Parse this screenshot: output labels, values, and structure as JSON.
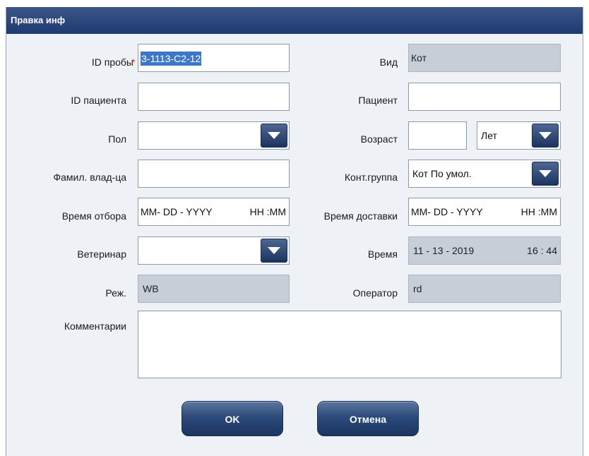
{
  "window": {
    "title": "Правка инф"
  },
  "sample_id": {
    "label": "ID пробы",
    "required_mark": "*",
    "value": "3-1113-C2-12"
  },
  "species": {
    "label": "Вид",
    "value": "Кот"
  },
  "patient_id": {
    "label": "ID пациента",
    "value": ""
  },
  "patient": {
    "label": "Пациент",
    "value": ""
  },
  "sex": {
    "label": "Пол",
    "value": ""
  },
  "age": {
    "label": "Возраст",
    "value": "",
    "unit": "Лет"
  },
  "owner": {
    "label": "Фамил. влад-ца",
    "value": ""
  },
  "ref_group": {
    "label": "Конт.группа",
    "value": "Кот По умол."
  },
  "draw_time": {
    "label": "Время отбора",
    "date": "MM- DD -  YYYY",
    "time": "HH :MM"
  },
  "delivery_time": {
    "label": "Время доставки",
    "date": "MM- DD -  YYYY",
    "time": "HH :MM"
  },
  "vet": {
    "label": "Ветеринар",
    "value": ""
  },
  "time": {
    "label": "Время",
    "date": "11 - 13 -  2019",
    "time": "16 : 44"
  },
  "mode": {
    "label": "Реж.",
    "value": "WB"
  },
  "operator": {
    "label": "Оператор",
    "value": "rd"
  },
  "comments": {
    "label": "Комментарии",
    "value": ""
  },
  "buttons": {
    "ok": "OK",
    "cancel": "Отмена"
  },
  "icons": {
    "dropdown": "chevron-down-icon"
  },
  "colors": {
    "titlebar": "#1e3a70",
    "button": "#2c4a7a",
    "readonly_field": "#c7ced8",
    "required": "#d42a2a",
    "selection": "#3c78c6"
  }
}
